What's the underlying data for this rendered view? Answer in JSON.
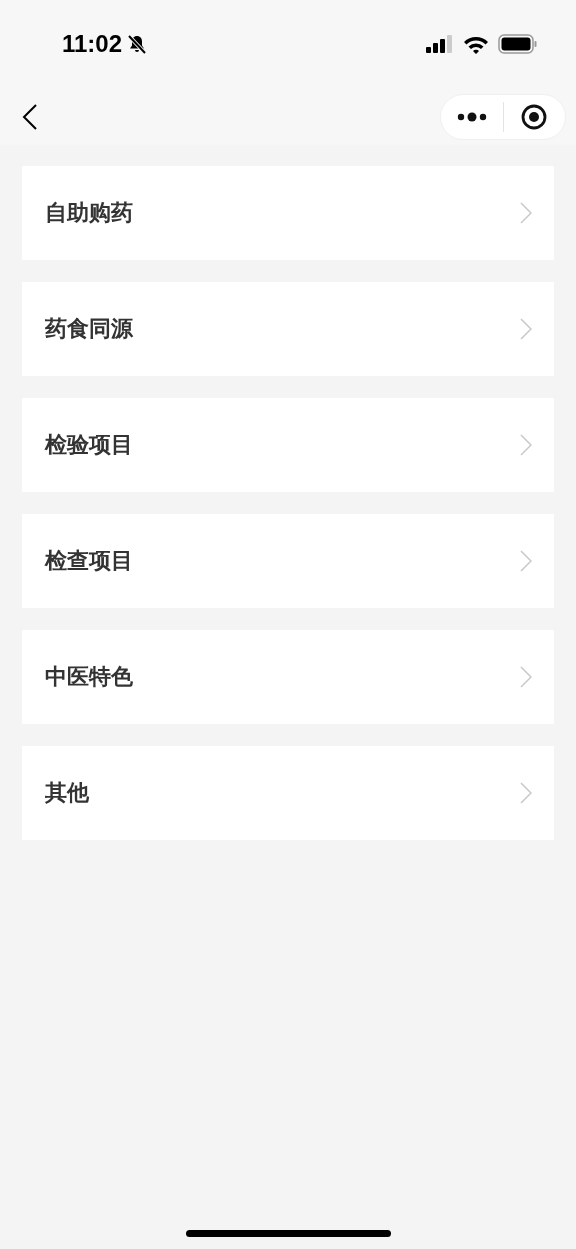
{
  "status_bar": {
    "time": "11:02"
  },
  "menu_items": [
    {
      "label": "自助购药"
    },
    {
      "label": "药食同源"
    },
    {
      "label": "检验项目"
    },
    {
      "label": "检查项目"
    },
    {
      "label": "中医特色"
    },
    {
      "label": "其他"
    }
  ]
}
